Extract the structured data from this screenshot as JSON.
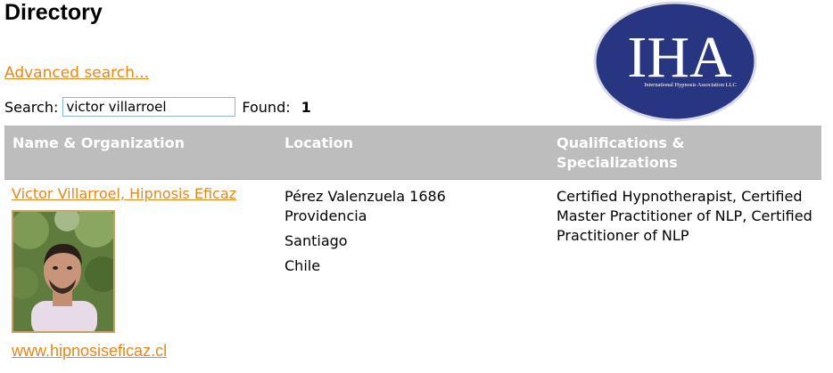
{
  "page": {
    "title": "Directory",
    "advanced_search_label": "Advanced search..."
  },
  "search": {
    "label": "Search:",
    "value": "victor villarroel",
    "found_label": "Found:",
    "found_count": "1"
  },
  "logo": {
    "letters": "IHA",
    "caption": "International Hypnosis Association LLC",
    "colors": {
      "oval": "#283580",
      "letters": "#ffffff"
    }
  },
  "table": {
    "headers": {
      "name": "Name & Organization",
      "location": "Location",
      "qualifications_line1": "Qualifications &",
      "qualifications_line2": "Specializations"
    },
    "rows": [
      {
        "name": "Victor Villarroel, Hipnosis Eficaz",
        "website": "www.hipnosiseficaz.cl",
        "address_line1": "Pérez Valenzuela 1686",
        "address_line2": "Providencia",
        "city": "Santiago",
        "country": "Chile",
        "qualifications_line1": "Certified Hypnotherapist, Certified",
        "qualifications_line2": "Master Practitioner of NLP, Certified",
        "qualifications_line3": "Practitioner of NLP"
      }
    ]
  },
  "colors": {
    "link": "#e8861a",
    "header_bg": "#bdbdbd",
    "header_text": "#ffffff",
    "photo_border": "#c9a066"
  }
}
